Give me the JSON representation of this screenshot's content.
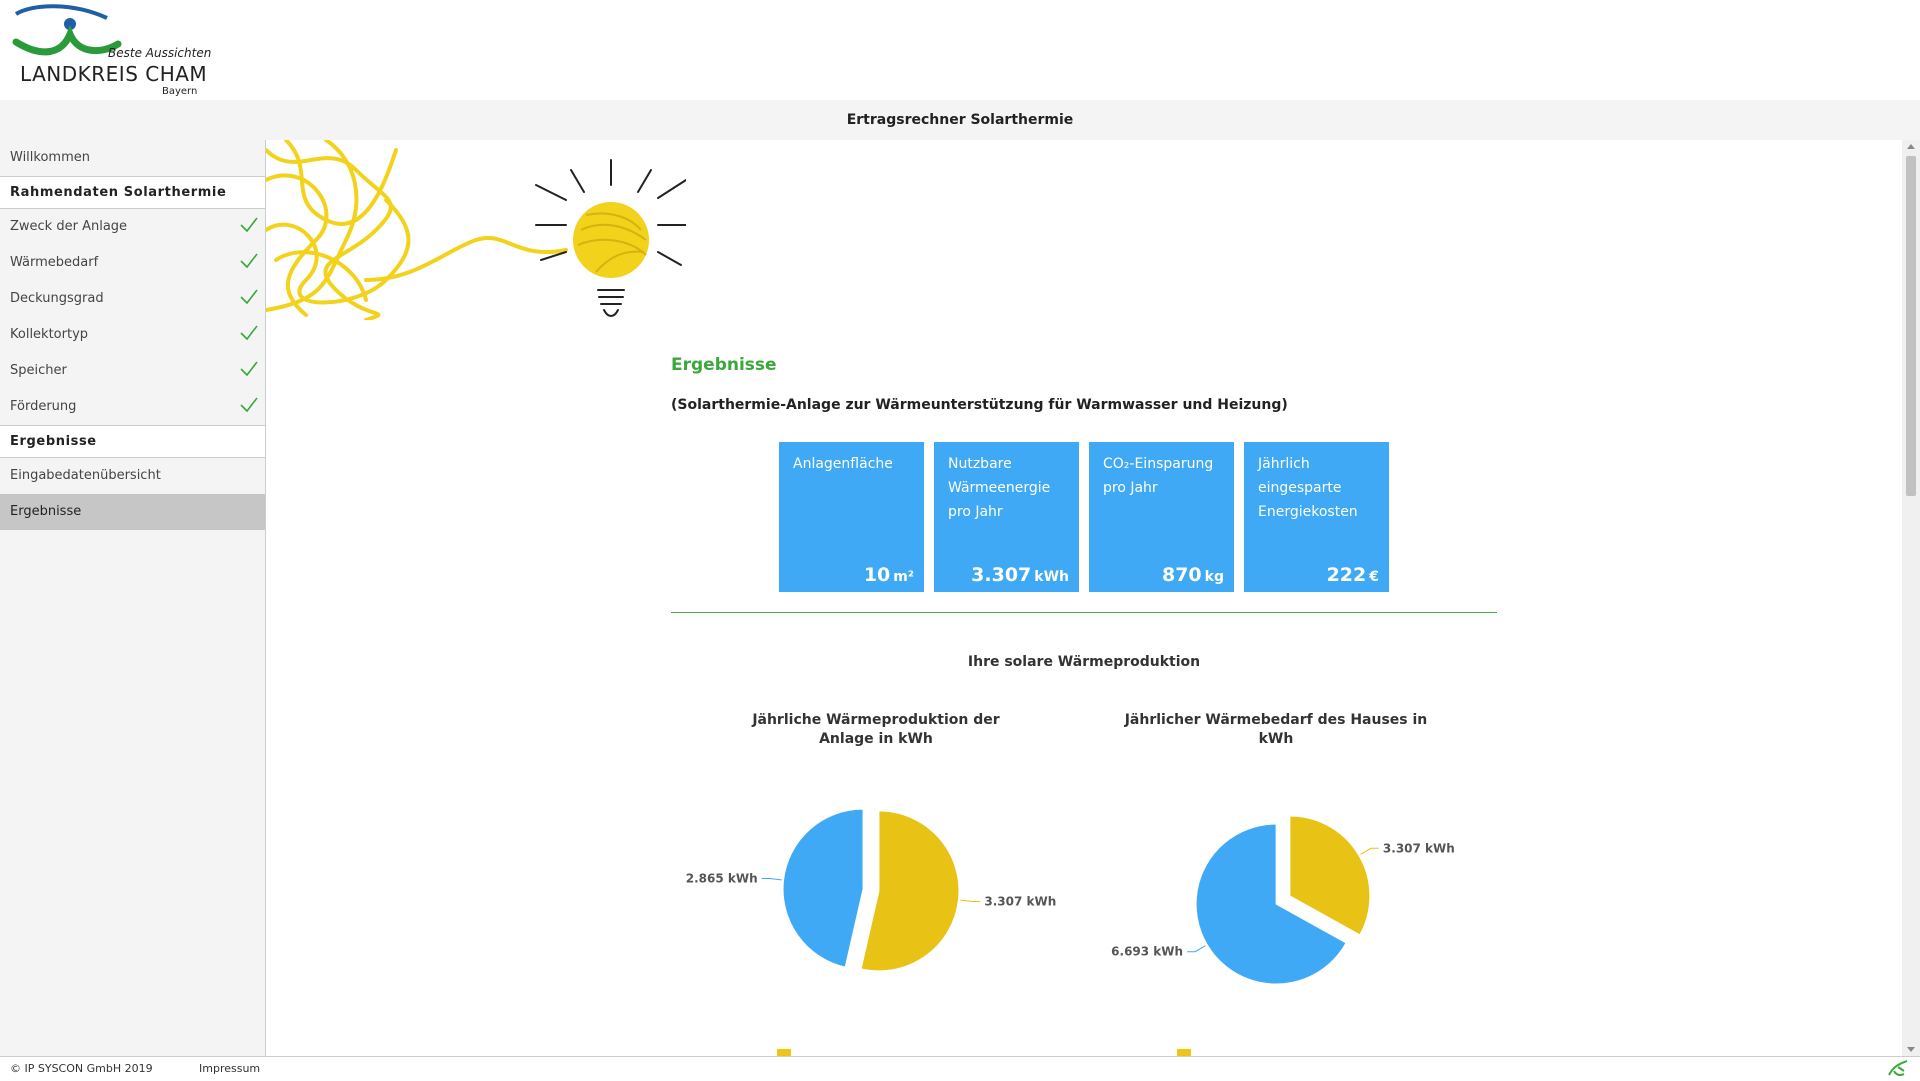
{
  "logo": {
    "tagline": "Beste Aussichten",
    "name": "LANDKREIS CHAM",
    "region": "Bayern"
  },
  "app": {
    "title": "Ertragsrechner Solarthermie"
  },
  "sidebar": {
    "items": [
      {
        "label": "Willkommen",
        "type": "item"
      },
      {
        "label": "Rahmendaten Solarthermie",
        "type": "section"
      },
      {
        "label": "Zweck der Anlage",
        "type": "item",
        "done": true
      },
      {
        "label": "Wärmebedarf",
        "type": "item",
        "done": true
      },
      {
        "label": "Deckungsgrad",
        "type": "item",
        "done": true
      },
      {
        "label": "Kollektortyp",
        "type": "item",
        "done": true
      },
      {
        "label": "Speicher",
        "type": "item",
        "done": true
      },
      {
        "label": "Förderung",
        "type": "item",
        "done": true
      },
      {
        "label": "Ergebnisse",
        "type": "section"
      },
      {
        "label": "Eingabedatenübersicht",
        "type": "item"
      },
      {
        "label": "Ergebnisse",
        "type": "item",
        "active": true
      }
    ]
  },
  "results": {
    "title": "Ergebnisse",
    "subtitle": "(Solarthermie-Anlage zur Wärmeunterstützung für Warmwasser und Heizung)",
    "cards": [
      {
        "label": "Anlagenfläche",
        "value": "10",
        "unit": "m²"
      },
      {
        "label": "Nutzbare Wärmeenergie pro Jahr",
        "value": "3.307",
        "unit": "kWh"
      },
      {
        "label": "CO₂-Einsparung pro Jahr",
        "value": "870",
        "unit": "kg"
      },
      {
        "label": "Jährlich eingesparte Energiekosten",
        "value": "222",
        "unit": "€"
      }
    ],
    "section_title": "Ihre solare Wärmeproduktion"
  },
  "chart_data": [
    {
      "type": "pie",
      "title": "Jährliche Wärmeproduktion der Anlage in kWh",
      "slices": [
        {
          "label": "3.307 kWh",
          "value": 3307,
          "color": "#e8c214"
        },
        {
          "label": "2.865 kWh",
          "value": 2865,
          "color": "#3fa9f5"
        }
      ]
    },
    {
      "type": "pie",
      "title": "Jährlicher Wärmebedarf des Hauses in kWh",
      "slices": [
        {
          "label": "3.307 kWh",
          "value": 3307,
          "color": "#e8c214"
        },
        {
          "label": "6.693 kWh",
          "value": 6693,
          "color": "#3fa9f5"
        }
      ]
    }
  ],
  "footer": {
    "copyright": "© IP SYSCON GmbH 2019",
    "impressum": "Impressum",
    "icon": "leaf-icon"
  },
  "colors": {
    "accent_green": "#3aa83a",
    "card_blue": "#3fa9f5",
    "pie_yellow": "#e8c214"
  }
}
